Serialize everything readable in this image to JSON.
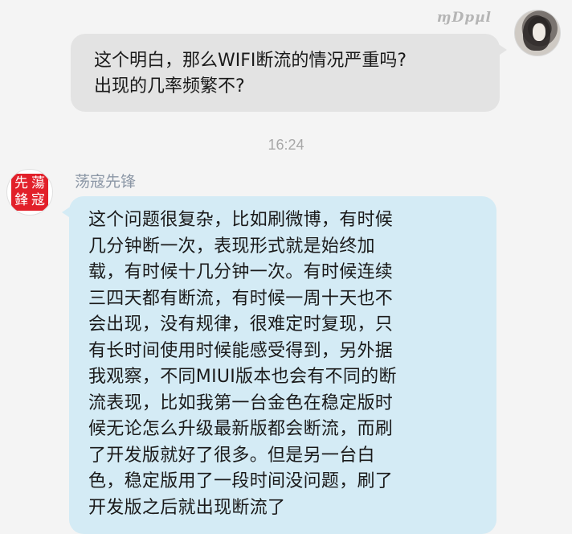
{
  "outgoing": {
    "sender_name": "ɱDpµl",
    "avatar": "anime-girl-avatar",
    "lines": [
      "这个明白，那么WIFI断流的情况严重吗?",
      "出现的几率频繁不?"
    ]
  },
  "timestamp": "16:24",
  "incoming": {
    "sender_name": "荡寇先锋",
    "avatar": "red-seal-avatar",
    "seal_chars": [
      "先",
      "蕩",
      "鋒",
      "寇"
    ],
    "lines": [
      "这个问题很复杂，比如刷微博，有时候",
      "几分钟断一次，表现形式就是始终加",
      "载，有时候十几分钟一次。有时候连续",
      "三四天都有断流，有时候一周十天也不",
      "会出现，没有规律，很难定时复现，只",
      "有长时间使用时候能感受得到，另外据",
      "我观察，不同MIUI版本也会有不同的断",
      "流表现，比如我第一台金色在稳定版时",
      "候无论怎么升级最新版都会断流，而刷",
      "了开发版就好了很多。但是另一台白",
      "色，稳定版用了一段时间没问题，刷了",
      "开发版之后就出现断流了"
    ]
  },
  "colors": {
    "background": "#f4f4f4",
    "outgoing_bubble": "#e3e3e3",
    "incoming_bubble": "#d4ebf5",
    "seal_red": "#e2202a",
    "name_gray_blue": "#8c97a6"
  }
}
